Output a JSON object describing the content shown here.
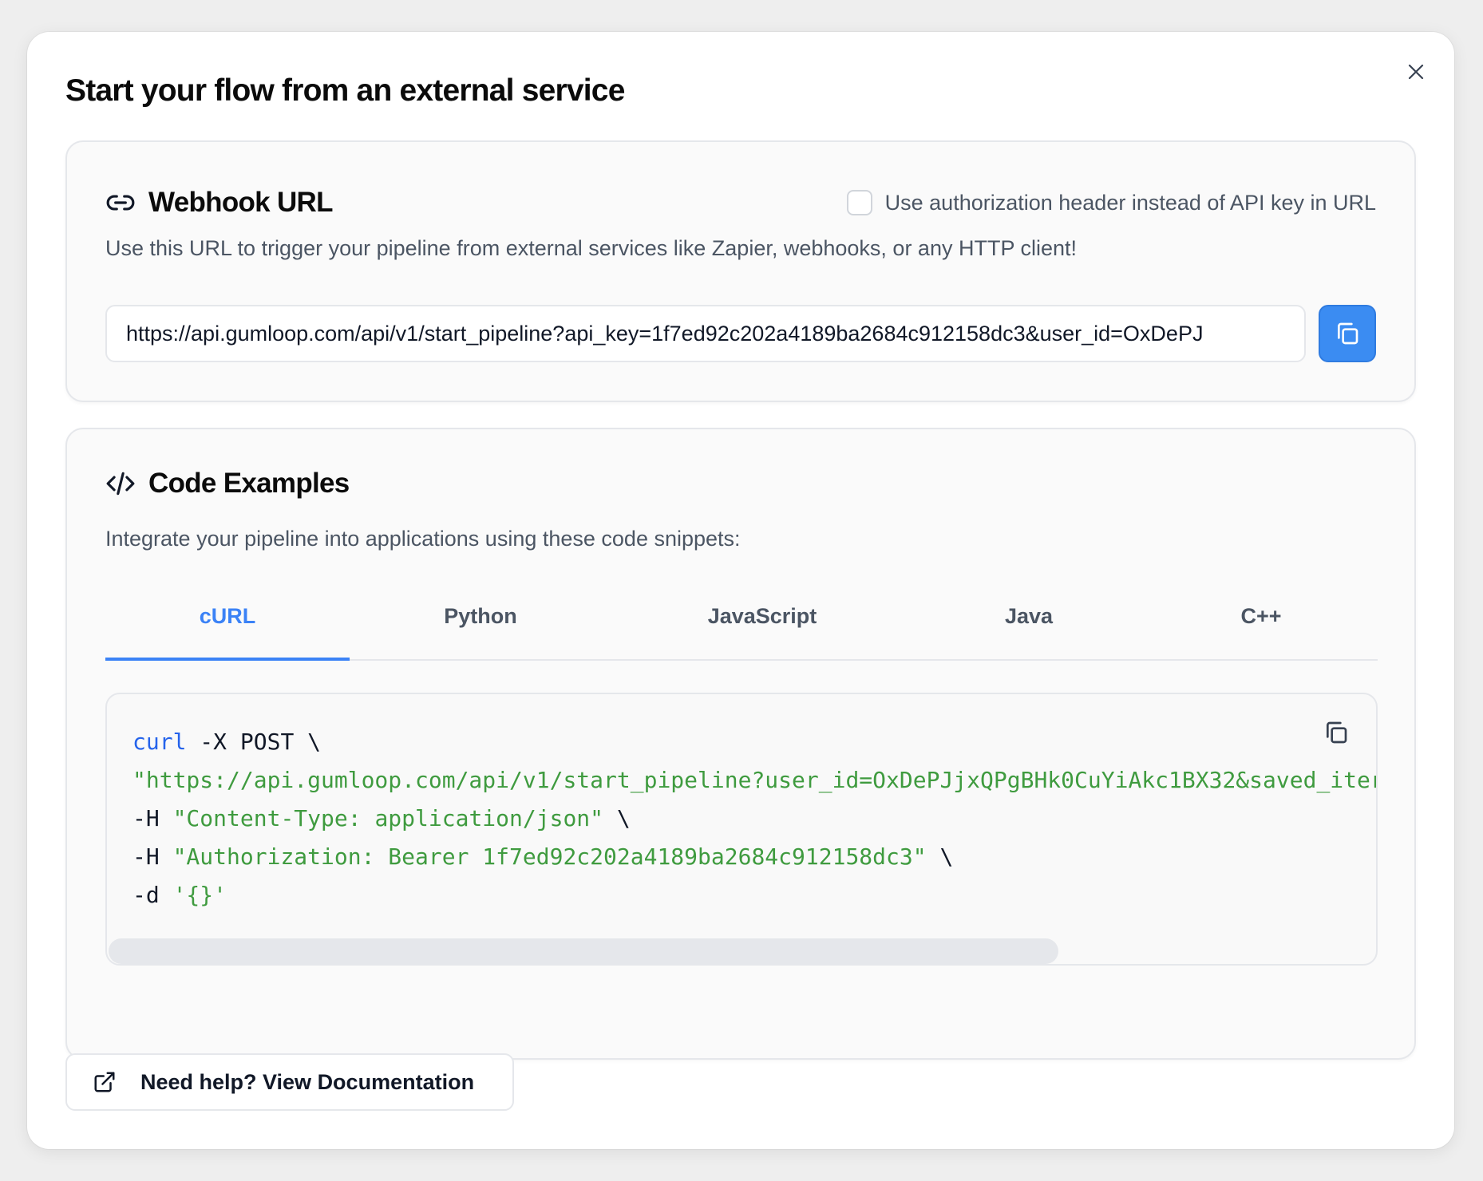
{
  "dialog": {
    "title": "Start your flow from an external service",
    "close_icon": "close-icon"
  },
  "webhook": {
    "icon": "link-icon",
    "title": "Webhook URL",
    "auth_toggle_label": "Use authorization header instead of API key in URL",
    "auth_toggle_checked": false,
    "description": "Use this URL to trigger your pipeline from external services like Zapier, webhooks, or any HTTP client!",
    "url": "https://api.gumloop.com/api/v1/start_pipeline?api_key=1f7ed92c202a4189ba2684c912158dc3&user_id=OxDePJ",
    "copy_icon": "copy-icon"
  },
  "code_examples": {
    "icon": "code-icon",
    "title": "Code Examples",
    "description": "Integrate your pipeline into applications using these code snippets:",
    "tabs": [
      {
        "label": "cURL",
        "active": true
      },
      {
        "label": "Python",
        "active": false
      },
      {
        "label": "JavaScript",
        "active": false
      },
      {
        "label": "Java",
        "active": false
      },
      {
        "label": "C++",
        "active": false
      }
    ],
    "code": {
      "line1_cmd": "curl",
      "line1_rest": " -X POST \\",
      "line2_str": "\"https://api.gumloop.com/api/v1/start_pipeline?user_id=OxDePJjxQPgBHk0CuYiAkc1BX32&saved_iter",
      "line3_flag": "-H ",
      "line3_str": "\"Content-Type: application/json\"",
      "line3_end": " \\",
      "line4_flag": "-H ",
      "line4_str": "\"Authorization: Bearer 1f7ed92c202a4189ba2684c912158dc3\"",
      "line4_end": " \\",
      "line5_flag": "-d ",
      "line5_str": "'{}'"
    },
    "scroll_position": 0.0
  },
  "help": {
    "icon": "external-link-icon",
    "label": "Need help? View Documentation"
  }
}
